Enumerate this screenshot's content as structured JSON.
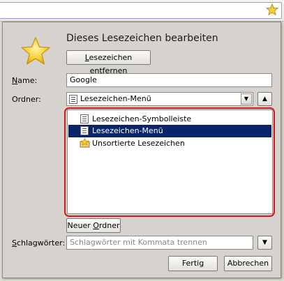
{
  "dialog": {
    "title": "Dieses Lesezeichen bearbeiten",
    "remove_button": {
      "prefix": "L",
      "rest": "esezeichen entfernen"
    },
    "name_label": {
      "prefix": "N",
      "rest": "ame:"
    },
    "name_value": "Google",
    "folder_label": "Ordner:",
    "folder_value": "Lesezeichen-Menü",
    "tree_items": [
      {
        "label": "Lesezeichen-Symbolleiste",
        "icon": "toolbar-folder-icon",
        "selected": false
      },
      {
        "label": "Lesezeichen-Menü",
        "icon": "menu-folder-icon",
        "selected": true
      },
      {
        "label": "Unsortierte Lesezeichen",
        "icon": "unsorted-bookmarks-icon",
        "selected": false
      }
    ],
    "new_folder_button": {
      "prefix": "Neuer ",
      "accel": "O",
      "rest": "rdner"
    },
    "tags_label": {
      "prefix": "S",
      "rest": "chlagwörter:"
    },
    "tags_placeholder": "Schlagwörter mit Kommata trennen",
    "done_button": "Fertig",
    "cancel_button": "Abbrechen"
  },
  "colors": {
    "highlight_frame": "#d9141a",
    "selection": "#0a246a"
  }
}
